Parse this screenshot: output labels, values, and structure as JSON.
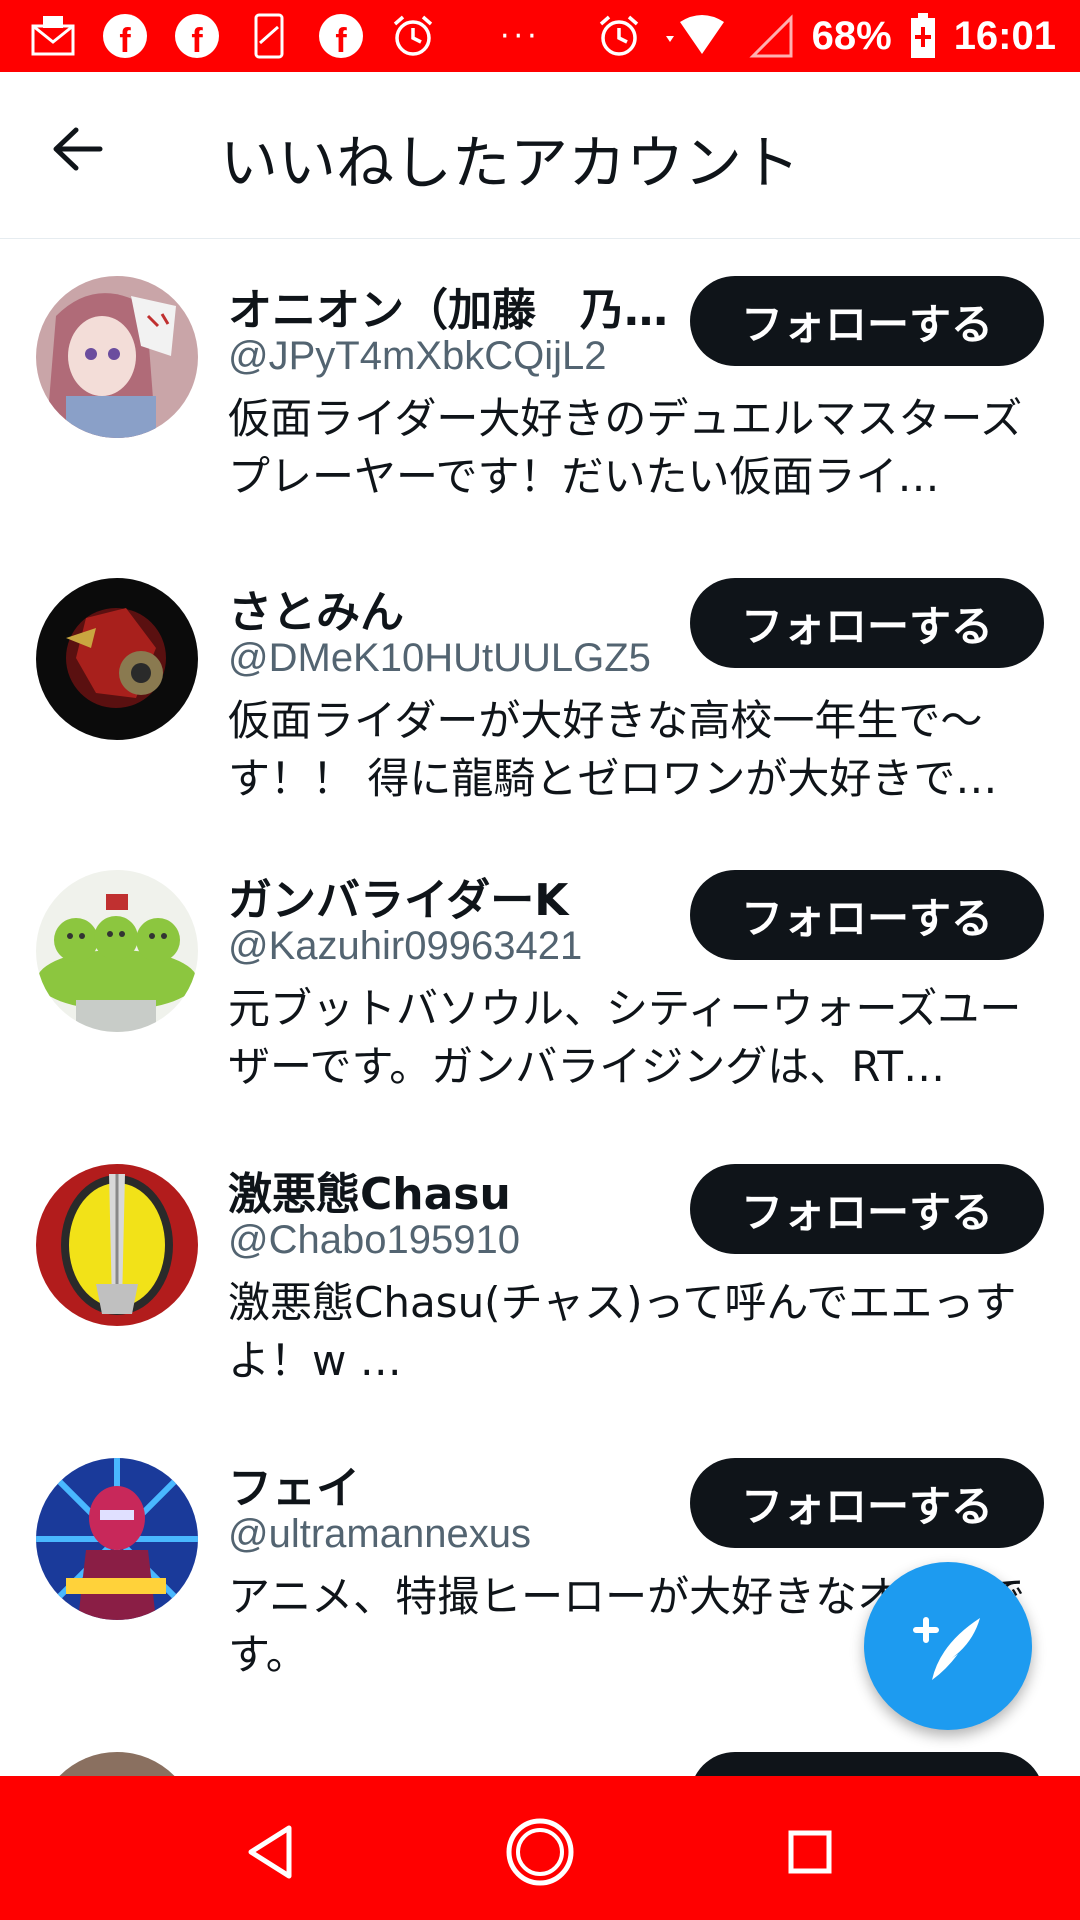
{
  "status_bar": {
    "battery": "68%",
    "time": "16:01",
    "overflow": "···",
    "left_icons": [
      "mail-icon",
      "facebook-icon",
      "facebook-icon",
      "phone-icon",
      "facebook-icon",
      "alarm-icon"
    ],
    "right_icons": [
      "alarm-icon",
      "wifi-icon",
      "signal-icon",
      "battery-icon"
    ],
    "bg_color": "#ff0000"
  },
  "header": {
    "title": "いいねしたアカウント",
    "back_icon": "arrow-left-icon"
  },
  "follow_label": "フォローする",
  "users": [
    {
      "name": "オニオン（加藤　乃…",
      "handle": "@JPyT4mXbkCQijL2",
      "bio": "仮面ライダー大好きのデュエルマスターズプレーヤーです！だいたい仮面ライ…"
    },
    {
      "name": "さとみん",
      "handle": "@DMeK10HUtUULGZ5",
      "bio": "仮面ライダーが大好きな高校一年生で〜す！！ 得に龍騎とゼロワンが大好きで…"
    },
    {
      "name": "ガンバライダーK",
      "handle": "@Kazuhir09963421",
      "bio": "元ブットバソウル、シティーウォーズユーザーです。ガンバライジングは、RT…"
    },
    {
      "name": "激悪態Chasu",
      "handle": "@Chabo195910",
      "bio": "激悪態Chasu(チャス)って呼んでエエっすよ！w …"
    },
    {
      "name": "フェイ",
      "handle": "@ultramannexus",
      "bio": "アニメ、特撮ヒーローが大好きなオタクです。"
    }
  ],
  "fab": {
    "icon": "compose-tweet-icon",
    "color": "#1d9bf0"
  },
  "nav": {
    "back_icon": "nav-back-icon",
    "home_icon": "nav-home-icon",
    "recents_icon": "nav-recents-icon",
    "bg_color": "#ff0000"
  }
}
